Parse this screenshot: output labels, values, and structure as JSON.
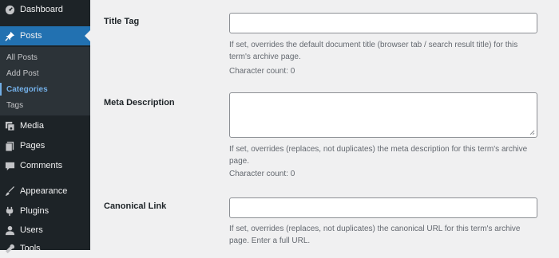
{
  "sidebar": {
    "dashboard": {
      "label": "Dashboard",
      "icon": "dashboard-icon"
    },
    "posts": {
      "label": "Posts",
      "icon": "pin-icon"
    },
    "posts_submenu": [
      {
        "label": "All Posts"
      },
      {
        "label": "Add Post"
      },
      {
        "label": "Categories"
      },
      {
        "label": "Tags"
      }
    ],
    "media": {
      "label": "Media",
      "icon": "media-icon"
    },
    "pages": {
      "label": "Pages",
      "icon": "pages-icon"
    },
    "comments": {
      "label": "Comments",
      "icon": "comment-icon"
    },
    "appearance": {
      "label": "Appearance",
      "icon": "brush-icon"
    },
    "plugins": {
      "label": "Plugins",
      "icon": "plugin-icon"
    },
    "users": {
      "label": "Users",
      "icon": "user-icon"
    },
    "tools": {
      "label": "Tools",
      "icon": "wrench-icon"
    }
  },
  "form": {
    "title_tag": {
      "label": "Title Tag",
      "value": "",
      "description": "If set, overrides the default document title (browser tab / search result title) for this term's archive page.",
      "count": "Character count: 0"
    },
    "meta_description": {
      "label": "Meta Description",
      "value": "",
      "description": "If set, overrides (replaces, not duplicates) the meta description for this term's archive page.",
      "count": "Character count: 0"
    },
    "canonical_link": {
      "label": "Canonical Link",
      "value": "",
      "description": "If set, overrides (replaces, not duplicates) the canonical URL for this term's archive page. Enter a full URL."
    }
  },
  "colors": {
    "sidebar_bg": "#1d2327",
    "active_bg": "#2271b1",
    "current_sub": "#72aee6"
  }
}
